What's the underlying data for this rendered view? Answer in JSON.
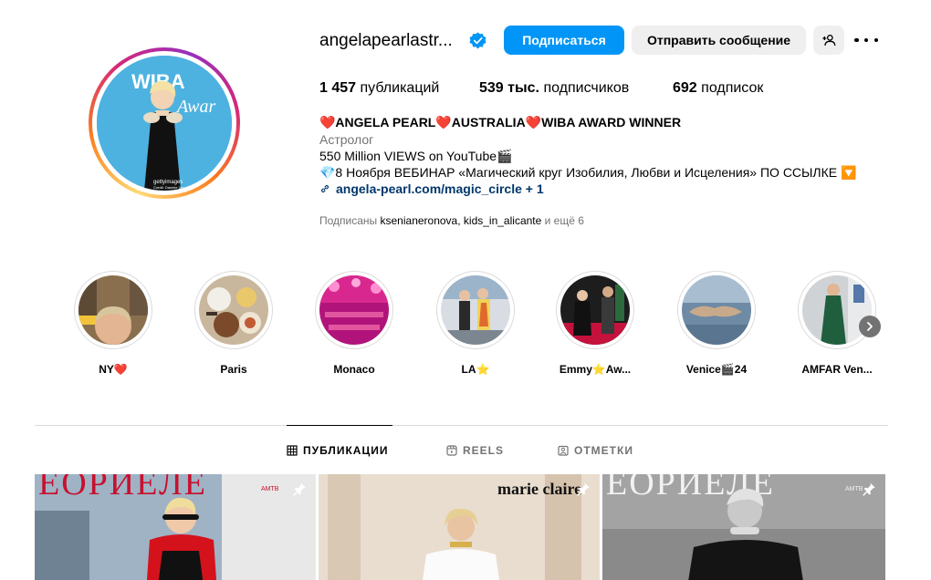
{
  "profile": {
    "username": "angelapearlastr...",
    "follow_button": "Подписаться",
    "message_button": "Отправить сообщение",
    "stats": {
      "posts_count": "1 457",
      "posts_label": "публикаций",
      "followers_count": "539 тыс.",
      "followers_label": "подписчиков",
      "following_count": "692",
      "following_label": "подписок"
    },
    "bio": {
      "name_line": "❤️ANGELA PEARL❤️AUSTRALIA❤️WIBA AWARD WINNER",
      "category": "Астролог",
      "line1": "550 Million VIEWS on YouTube🎬",
      "line2": "💎8 Ноября ВЕБИНАР «Магический круг Изобилия, Любви и Исцеления» ПО ССЫЛКЕ 🔽",
      "link": "angela-pearl.com/magic_circle + 1"
    },
    "followed_by": {
      "prefix": "Подписаны ",
      "account1": "ksenianeronova",
      "separator": ", ",
      "account2": "kids_in_alicante",
      "suffix": " и ещё 6"
    },
    "avatar_text": {
      "wiba": "WIBA",
      "awards": "Awar",
      "getty": "gettyimages",
      "credit": "Credit: Daniele Ven"
    }
  },
  "highlights": [
    {
      "label": "NY❤️"
    },
    {
      "label": "Paris"
    },
    {
      "label": "Monaco"
    },
    {
      "label": "LA⭐️"
    },
    {
      "label": "Emmy⭐️Aw..."
    },
    {
      "label": "Venice🎬24"
    },
    {
      "label": "AMFAR Ven..."
    }
  ],
  "tabs": [
    {
      "label": "ПУБЛИКАЦИИ",
      "active": true
    },
    {
      "label": "REELS",
      "active": false
    },
    {
      "label": "ОТМЕТКИ",
      "active": false
    }
  ],
  "posts": [
    {
      "magazine": "ЕОРИЕЛЕ",
      "badge": "АМТВ"
    },
    {
      "magazine": "marie claire"
    },
    {
      "magazine": "ЕОРИЕЛЕ",
      "badge": "АМТВ"
    }
  ],
  "colors": {
    "primary_button": "#0095f6",
    "secondary_button": "#efefef",
    "link": "#00376b",
    "muted_text": "#737373",
    "verified_badge": "#0095f6"
  }
}
